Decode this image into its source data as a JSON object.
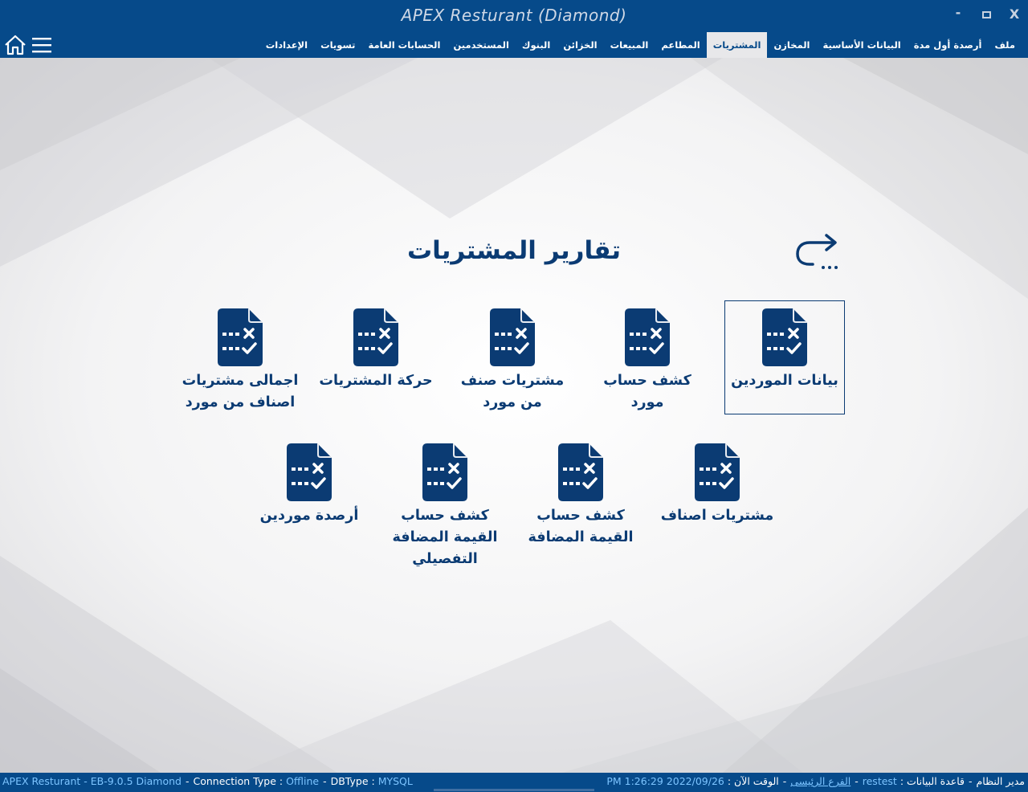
{
  "window": {
    "title": "APEX Resturant (Diamond)",
    "minimize": "-",
    "close": "X"
  },
  "menu": {
    "items": [
      {
        "label": "ملف"
      },
      {
        "label": "أرصدة أول مدة"
      },
      {
        "label": "البيانات الأساسية"
      },
      {
        "label": "المخازن"
      },
      {
        "label": "المشتريات",
        "active": true
      },
      {
        "label": "المطاعم"
      },
      {
        "label": "المبيعات"
      },
      {
        "label": "الخزائن"
      },
      {
        "label": "البنوك"
      },
      {
        "label": "المستخدمين"
      },
      {
        "label": "الحسابات العامة"
      },
      {
        "label": "تسويات"
      },
      {
        "label": "الإعدادات"
      }
    ]
  },
  "page": {
    "title": "تقارير المشتريات",
    "back_label": "..."
  },
  "tiles": [
    {
      "label": "بيانات الموردين",
      "selected": true
    },
    {
      "label": "كشف حساب\nمورد"
    },
    {
      "label": "مشتريات صنف\nمن مورد"
    },
    {
      "label": "حركة المشتريات"
    },
    {
      "label": "اجمالى مشتريات\nاصناف من مورد"
    },
    {
      "label": "مشتريات اصناف"
    },
    {
      "label": "كشف حساب\nالقيمة المضافة"
    },
    {
      "label": "كشف حساب\nالقيمة المضافة\nالتفصيلي"
    },
    {
      "label": "أرصدة موردين"
    }
  ],
  "status": {
    "app_version": "APEX Resturant - EB-9.0.5  Diamond",
    "connection_label": "Connection Type :",
    "connection_value": "Offline",
    "dbtype_label": "DBType :",
    "dbtype_value": "MYSQL",
    "user": "مدير النظام",
    "db_label": "قاعدة البيانات :",
    "db_value": "restest",
    "branch": "الفرع الرئيسى",
    "time_label": "الوقت الآن :",
    "time_value": "2022/09/26 1:26:29 PM",
    "dash": "-"
  },
  "colors": {
    "bar": "#064a8a",
    "accent": "#0b3b73",
    "status_highlight": "#7cc4ff"
  },
  "icons": {
    "home": "home-icon",
    "menu": "hamburger-icon",
    "back": "back-arrow-icon",
    "report": "report-document-icon"
  }
}
